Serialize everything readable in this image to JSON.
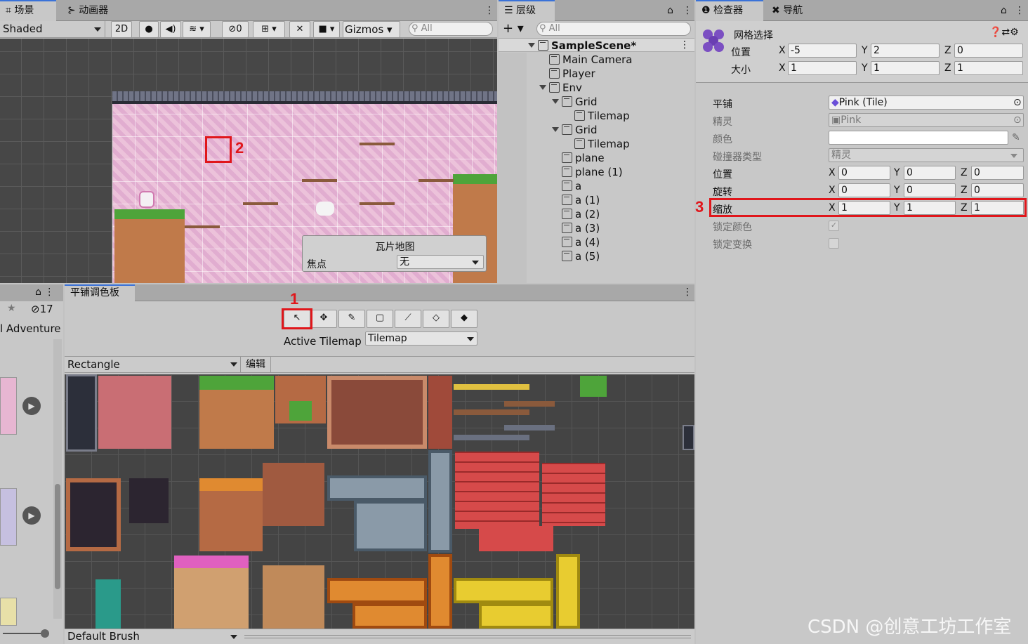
{
  "scene": {
    "tabs": [
      "场景",
      "动画器"
    ],
    "shading": "Shaded",
    "mode_2d": "2D",
    "hidden_count": "0",
    "gizmos": "Gizmos",
    "search_placeholder": "All"
  },
  "tile_overlay": {
    "title": "瓦片地图",
    "focus_label": "焦点",
    "focus_value": "无"
  },
  "hierarchy": {
    "tab": "层级",
    "search_placeholder": "All",
    "items": [
      {
        "label": "SampleScene*",
        "depth": 0
      },
      {
        "label": "Main Camera",
        "depth": 1
      },
      {
        "label": "Player",
        "depth": 1
      },
      {
        "label": "Env",
        "depth": 1
      },
      {
        "label": "Grid",
        "depth": 2
      },
      {
        "label": "Tilemap",
        "depth": 3
      },
      {
        "label": "Grid",
        "depth": 2
      },
      {
        "label": "Tilemap",
        "depth": 3
      },
      {
        "label": "plane",
        "depth": 2
      },
      {
        "label": "plane (1)",
        "depth": 2
      },
      {
        "label": "a",
        "depth": 2
      },
      {
        "label": "a (1)",
        "depth": 2
      },
      {
        "label": "a (2)",
        "depth": 2
      },
      {
        "label": "a (3)",
        "depth": 2
      },
      {
        "label": "a (4)",
        "depth": 2
      },
      {
        "label": "a (5)",
        "depth": 2
      }
    ]
  },
  "inspector": {
    "tabs": [
      "检查器",
      "导航"
    ],
    "title": "网格选择",
    "position_label": "位置",
    "size_label": "大小",
    "pos": {
      "x": "-5",
      "y": "2",
      "z": "0"
    },
    "size": {
      "x": "1",
      "y": "1",
      "z": "1"
    },
    "tile_label": "平铺",
    "tile_value": "Pink (Tile)",
    "sprite_label": "精灵",
    "sprite_value": "Pink",
    "color_label": "颜色",
    "collider_label": "碰撞器类型",
    "collider_value": "精灵",
    "t_position_label": "位置",
    "rotation_label": "旋转",
    "scale_label": "缩放",
    "lock_color_label": "锁定颜色",
    "lock_transform_label": "锁定变换",
    "t_pos": {
      "x": "0",
      "y": "0",
      "z": "0"
    },
    "rot": {
      "x": "0",
      "y": "0",
      "z": "0"
    },
    "scale": {
      "x": "1",
      "y": "1",
      "z": "1"
    }
  },
  "project": {
    "count": "17",
    "label": "l Adventure"
  },
  "palette": {
    "tab": "平铺调色板",
    "active_tilemap_label": "Active Tilemap",
    "active_tilemap_value": "Tilemap",
    "palette_value": "Rectangle",
    "edit_label": "编辑",
    "brush_value": "Default Brush"
  },
  "annotations": [
    "1",
    "2",
    "3"
  ],
  "watermark": "CSDN @创意工坊工作室"
}
